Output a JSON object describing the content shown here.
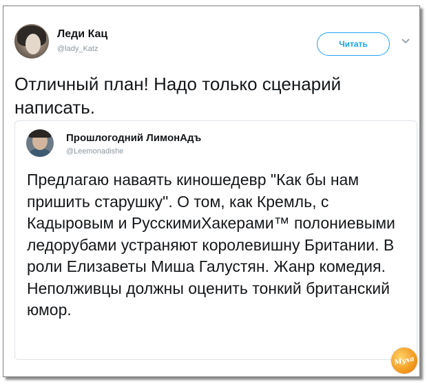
{
  "tweet": {
    "author_name": "Леди Кац",
    "author_handle": "@lady_Katz",
    "follow_label": "Читать",
    "text": "Отличный план! Надо только сценарий написать."
  },
  "quoted": {
    "author_name": "Прошлогодний ЛимонАдъ",
    "author_handle": "@Leemonadishe",
    "text": "Предлагаю наваять киношедевр \"Как бы нам пришить старушку\". О том, как Кремль, с Кадыровым и РусскимиХакерами™ полониевыми ледорубами устраняют королевишну Британии. В роли Елизаветы Миша Галустян. Жанр комедия. Неполживцы должны оценить тонкий британский юмор."
  },
  "watermark": {
    "text": "Мухa"
  },
  "colors": {
    "accent": "#1da1f2",
    "text": "#14171a",
    "muted": "#8b969f",
    "border": "#dde3e8",
    "watermark": "#f39a1e"
  },
  "icons": {
    "menu": "chevron-down-icon"
  }
}
